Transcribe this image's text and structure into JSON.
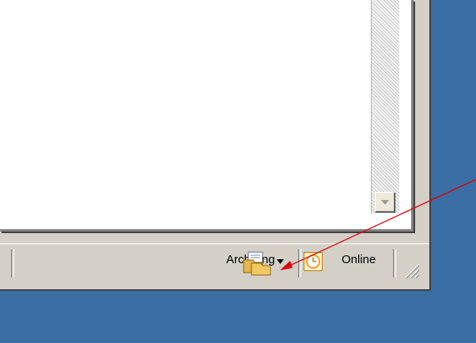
{
  "statusbar": {
    "archiving_label": "Archiving",
    "online_label": "Online"
  },
  "icons": {
    "folders": "archive-folders-icon",
    "dropdown": "dropdown-arrow-icon",
    "online": "clock-icon",
    "grip": "resize-grip-icon",
    "scroll_down": "scroll-down-arrow-icon"
  },
  "colors": {
    "desktop": "#3a6ea5",
    "window_face": "#d4d0c8",
    "annotation_arrow": "#e00000",
    "online_icon_accent": "#f5a020"
  }
}
